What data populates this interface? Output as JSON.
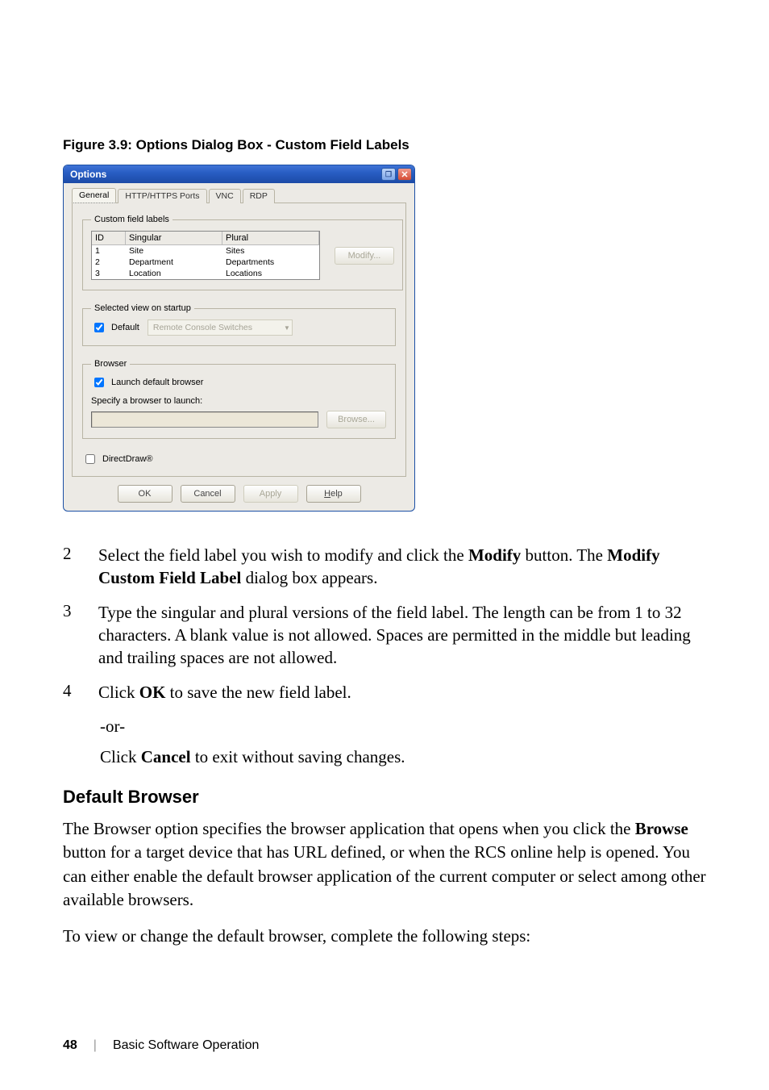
{
  "caption": "Figure 3.9: Options Dialog Box - Custom Field Labels",
  "dialog": {
    "title": "Options",
    "tabs": {
      "general": "General",
      "http": "HTTP/HTTPS Ports",
      "vnc": "VNC",
      "rdp": "RDP"
    },
    "labels": {
      "group_custom": "Custom field labels",
      "group_startup": "Selected view on startup",
      "group_browser": "Browser"
    },
    "table": {
      "head": {
        "id": "ID",
        "singular": "Singular",
        "plural": "Plural"
      },
      "rows": [
        {
          "id": "1",
          "singular": "Site",
          "plural": "Sites"
        },
        {
          "id": "2",
          "singular": "Department",
          "plural": "Departments"
        },
        {
          "id": "3",
          "singular": "Location",
          "plural": "Locations"
        }
      ]
    },
    "modify_btn": "Modify...",
    "startup": {
      "default_label": "Default",
      "dropdown_value": "Remote Console Switches"
    },
    "browser": {
      "launch_default": "Launch default browser",
      "specify": "Specify a browser to launch:",
      "browse_btn": "Browse..."
    },
    "directdraw": "DirectDraw®",
    "buttons": {
      "ok": "OK",
      "cancel": "Cancel",
      "apply": "Apply",
      "help": "Help"
    }
  },
  "steps": {
    "s2_a": "Select the field label you wish to modify and click the ",
    "s2_b": "Modify",
    "s2_c": " button. The ",
    "s2_d": "Modify Custom Field Label",
    "s2_e": " dialog box appears.",
    "s3": "Type the singular and plural versions of the field label. The length can be from 1 to 32 characters. A blank value is not allowed. Spaces are permitted in the middle but leading and trailing spaces are not allowed.",
    "s4_a": "Click ",
    "s4_b": "OK",
    "s4_c": " to save the new field label.",
    "or": "-or-",
    "s4_alt_a": "Click ",
    "s4_alt_b": "Cancel",
    "s4_alt_c": " to exit without saving changes."
  },
  "section": "Default Browser",
  "body1_a": "The Browser option specifies the browser application that opens when you click the ",
  "body1_b": "Browse",
  "body1_c": " button for a target device that has URL defined, or when the RCS online help is opened. You can either enable the default browser application of the current computer or select among other available browsers.",
  "body2": "To view or change the default browser, complete the following steps:",
  "footer": {
    "page": "48",
    "chapter": "Basic Software Operation"
  }
}
